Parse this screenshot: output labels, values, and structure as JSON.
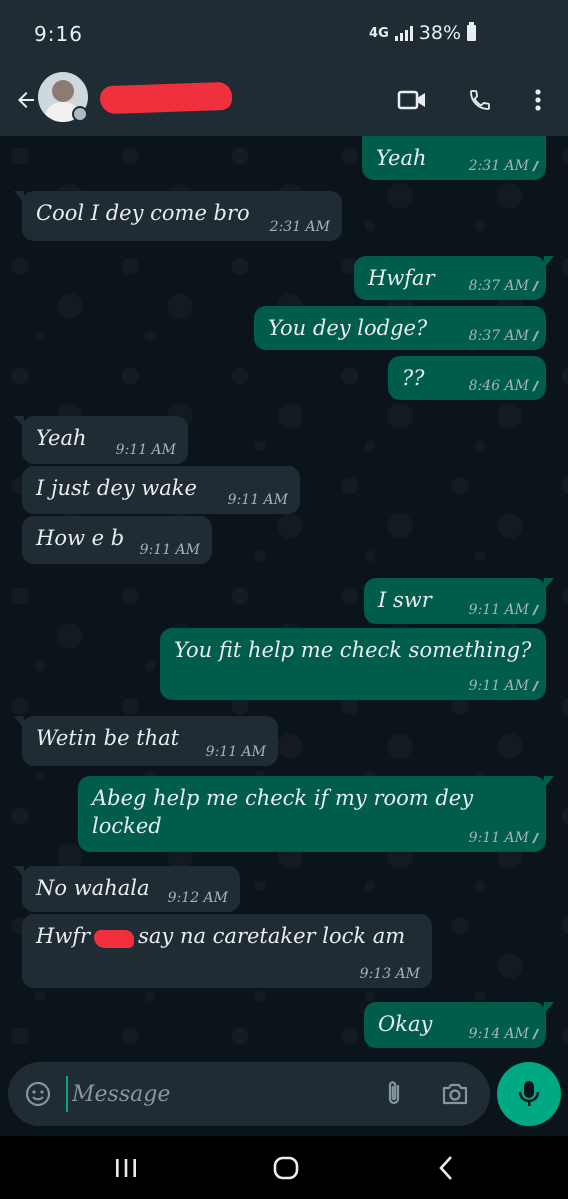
{
  "status_bar": {
    "time": "9:16",
    "network": "4G",
    "battery": "38%"
  },
  "header": {
    "contact_name": "",
    "icons": [
      "back-arrow-icon",
      "video-call-icon",
      "voice-call-icon",
      "more-options-icon"
    ]
  },
  "messages": [
    {
      "direction": "out",
      "text": "Yeah",
      "time": "2:31 AM",
      "read": true
    },
    {
      "direction": "in",
      "text": "Cool I dey come bro",
      "time": "2:31 AM"
    },
    {
      "direction": "out",
      "text": "Hwfar",
      "time": "8:37 AM",
      "read": true
    },
    {
      "direction": "out",
      "text": "You dey lodge?",
      "time": "8:37 AM",
      "read": true
    },
    {
      "direction": "out",
      "text": "??",
      "time": "8:46 AM",
      "read": true
    },
    {
      "direction": "in",
      "text": "Yeah",
      "time": "9:11 AM"
    },
    {
      "direction": "in",
      "text": "I just dey wake",
      "time": "9:11 AM"
    },
    {
      "direction": "in",
      "text": "How e b",
      "time": "9:11 AM"
    },
    {
      "direction": "out",
      "text": "I swr",
      "time": "9:11 AM",
      "read": true
    },
    {
      "direction": "out",
      "text": "You fit help me check something?",
      "time": "9:11 AM",
      "read": true
    },
    {
      "direction": "in",
      "text": "Wetin be that",
      "time": "9:11 AM"
    },
    {
      "direction": "out",
      "text_line1": "Abeg help me check if my room dey",
      "text_line2": "locked",
      "time": "9:11 AM",
      "read": true
    },
    {
      "direction": "in",
      "text": "No wahala",
      "time": "9:12 AM"
    },
    {
      "direction": "in",
      "text_before": "Hwfr",
      "text_after": "say na caretaker lock am",
      "time": "9:13 AM"
    },
    {
      "direction": "out",
      "text": "Okay",
      "time": "9:14 AM",
      "read": true
    }
  ],
  "composer": {
    "placeholder": "Message"
  },
  "colors": {
    "header_bg": "#1f2c34",
    "chat_bg": "#0b141a",
    "outgoing_bubble": "#005c4b",
    "incoming_bubble": "#202c33",
    "accent": "#00a884"
  }
}
